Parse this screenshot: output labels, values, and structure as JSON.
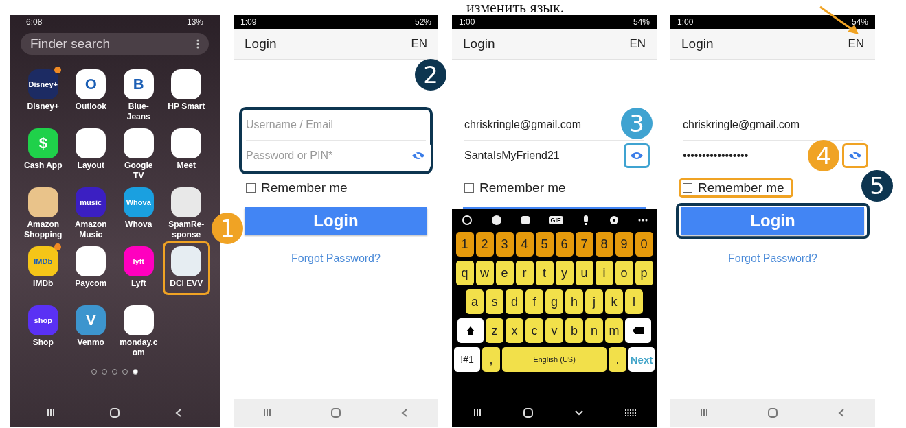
{
  "caption": "изменить язык.",
  "home_screen": {
    "status_bar": {
      "time": "6:08",
      "battery": "13%"
    },
    "search": {
      "placeholder": "Finder search"
    },
    "apps": [
      {
        "label": "Disney+",
        "color": "#1c2b63",
        "glyph": "Disney+",
        "badge": true,
        "highlighted": false
      },
      {
        "label": "Outlook",
        "color": "#ffffff",
        "glyph": "O",
        "badge": false,
        "highlighted": false
      },
      {
        "label": "Blue-\nJeans",
        "color": "#ffffff",
        "glyph": "B",
        "badge": false,
        "highlighted": false
      },
      {
        "label": "HP Smart",
        "color": "#ffffff",
        "badge": false,
        "highlighted": false
      },
      {
        "label": "Cash App",
        "color": "#1fd14a",
        "glyph": "$",
        "badge": false,
        "highlighted": false
      },
      {
        "label": "Layout",
        "color": "#ffffff",
        "badge": false,
        "highlighted": false
      },
      {
        "label": "Google TV",
        "color": "#ffffff",
        "badge": false,
        "highlighted": false
      },
      {
        "label": "Meet",
        "color": "#ffffff",
        "badge": false,
        "highlighted": false
      },
      {
        "label": "Amazon\nShopping",
        "color": "#e9c38a",
        "badge": false,
        "highlighted": false
      },
      {
        "label": "Amazon\nMusic",
        "color": "#3b1fc2",
        "glyph": "music",
        "badge": false,
        "highlighted": false
      },
      {
        "label": "Whova",
        "color": "#1aa0e0",
        "glyph": "Whova",
        "badge": false,
        "highlighted": false
      },
      {
        "label": "SpamRe-\nsponse",
        "color": "#e8e8e8",
        "badge": false,
        "highlighted": false
      },
      {
        "label": "IMDb",
        "color": "#f5c518",
        "glyph": "IMDb",
        "badge": true,
        "highlighted": false
      },
      {
        "label": "Paycom",
        "color": "#ffffff",
        "badge": false,
        "highlighted": false
      },
      {
        "label": "Lyft",
        "color": "#ff00bf",
        "glyph": "lyft",
        "badge": false,
        "highlighted": false
      },
      {
        "label": "DCI EVV",
        "color": "#e6edf2",
        "badge": false,
        "highlighted": true
      },
      {
        "label": "Shop",
        "color": "#5a31f4",
        "glyph": "shop",
        "badge": false,
        "highlighted": false
      },
      {
        "label": "Venmo",
        "color": "#3d95ce",
        "glyph": "V",
        "badge": false,
        "highlighted": false
      },
      {
        "label": "monday.c\nom",
        "color": "#ffffff",
        "badge": false,
        "highlighted": false
      }
    ],
    "page_dots": [
      {
        "selected": false
      },
      {
        "selected": false
      },
      {
        "selected": false
      },
      {
        "selected": false
      },
      {
        "selected": true
      }
    ],
    "callout": {
      "number": "1",
      "color": "#f0a324"
    }
  },
  "login_screens": [
    {
      "status_bar": {
        "time": "1:09",
        "battery": "52%"
      },
      "title": "Login",
      "language": "EN",
      "language_arrow": false,
      "form_callout": {
        "number": "2",
        "color": "#0d3550"
      },
      "username": {
        "placeholder": "Username / Email"
      },
      "password": {
        "placeholder": "Password or PIN*",
        "visible": false
      },
      "remember_me": {
        "label": "Remember me",
        "checked": false
      },
      "login_button": {
        "label": "Login",
        "covered": false
      },
      "forgot_link": "Forgot Password?"
    },
    {
      "status_bar": {
        "time": "1:00",
        "battery": "54%"
      },
      "title": "Login",
      "language": "EN",
      "language_arrow": false,
      "username": {
        "value": "chriskringle@gmail.com"
      },
      "password": {
        "value": "SantaIsMyFriend21",
        "visible": true,
        "eye_callout": {
          "number": "3",
          "color": "#3fa3d1"
        }
      },
      "remember_me": {
        "label": "Remember me",
        "checked": false
      },
      "login_button": {
        "covered": true
      },
      "keyboard": {
        "number_row": [
          "1",
          "2",
          "3",
          "4",
          "5",
          "6",
          "7",
          "8",
          "9",
          "0"
        ],
        "letter_rows": [
          [
            "q",
            "w",
            "e",
            "r",
            "t",
            "y",
            "u",
            "i",
            "o",
            "p"
          ],
          [
            "a",
            "s",
            "d",
            "f",
            "g",
            "h",
            "j",
            "k",
            "l"
          ],
          [
            "z",
            "x",
            "c",
            "v",
            "b",
            "n",
            "m"
          ]
        ],
        "symbols_key": "!#1",
        "comma": ",",
        "space": "English (US)",
        "period": ".",
        "next": "Next",
        "gif": "GIF"
      }
    },
    {
      "status_bar": {
        "time": "1:00",
        "battery": "54%"
      },
      "title": "Login",
      "language": "EN",
      "language_arrow": true,
      "username": {
        "value": "chriskringle@gmail.com"
      },
      "password": {
        "value": "•••••••••••••••••",
        "visible": false,
        "eye_callout": {
          "number": "4",
          "color": "#f0a324"
        }
      },
      "remember_me": {
        "label": "Remember me",
        "checked": false,
        "highlight": {
          "color": "#f0a324"
        }
      },
      "login_button": {
        "label": "Login",
        "covered": false,
        "callout": {
          "number": "5",
          "color": "#0d3550"
        }
      },
      "forgot_link": "Forgot Password?"
    }
  ]
}
